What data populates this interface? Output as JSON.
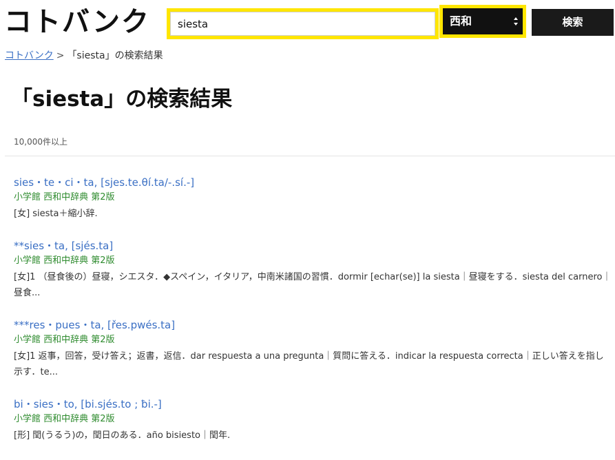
{
  "header": {
    "logo": "コトバンク",
    "search_value": "siesta",
    "dictionary_select": "西和",
    "search_button": "検索"
  },
  "breadcrumb": {
    "home": "コトバンク",
    "separator": ">",
    "current": "「siesta」の検索結果"
  },
  "page_title": "「siesta」の検索結果",
  "result_count": "10,000件以上",
  "results": [
    {
      "title": "sies・te・ci・ta, [sjes.te.θí.ta/-.sí.-]",
      "source": "小学館 西和中辞典 第2版",
      "snippet": "[女] siesta＋縮小辞."
    },
    {
      "title": "**sies・ta, [sjés.ta]",
      "source": "小学館 西和中辞典 第2版",
      "snippet": "[女]1 （昼食後の）昼寝，シエスタ．◆スペイン，イタリア，中南米諸国の習慣．dormir [echar(se)] la siesta｜昼寝をする．siesta del carnero｜昼食..."
    },
    {
      "title": "***res・pues・ta, [řes.pwés.ta]",
      "source": "小学館 西和中辞典 第2版",
      "snippet": "[女]1 返事，回答，受け答え；返書，返信．dar respuesta a una pregunta｜質問に答える．indicar la respuesta correcta｜正しい答えを指し示す．te..."
    },
    {
      "title": "bi・sies・to, [bi.sjés.to ; ƀi.-]",
      "source": "小学館 西和中辞典 第2版",
      "snippet": "[形] 閏(うるう)の，閏日のある．año bisiesto｜閏年."
    }
  ]
}
